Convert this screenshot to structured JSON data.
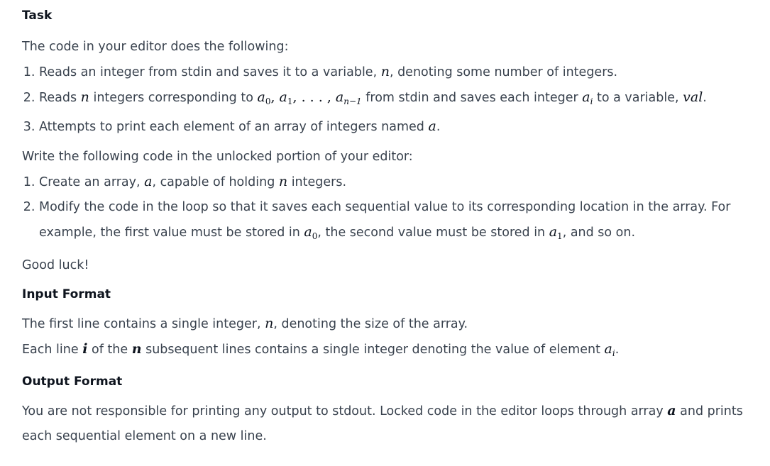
{
  "task": {
    "heading": "Task",
    "intro": "The code in your editor does the following:",
    "steps": {
      "s1_a": "Reads an integer from stdin and saves it to a variable, ",
      "s1_var": "n",
      "s1_b": ", denoting some number of integers.",
      "s2_a": "Reads ",
      "s2_var": "n",
      "s2_b": " integers corresponding to ",
      "s2_seq_a": "a",
      "s2_seq_0": "0",
      "s2_seq_sep1": ", ",
      "s2_seq_a1": "a",
      "s2_seq_1": "1",
      "s2_seq_dots": ", . . . , ",
      "s2_seq_an": "a",
      "s2_seq_n1": "n−1",
      "s2_c": " from stdin and saves each integer ",
      "s2_ai": "a",
      "s2_i": "i",
      "s2_d": " to a variable, ",
      "s2_val": "val",
      "s2_e": ".",
      "s3_a": "Attempts to print each element of an array of integers named ",
      "s3_var": "a",
      "s3_b": "."
    },
    "write_intro": "Write the following code in the unlocked portion of your editor:",
    "write_steps": {
      "w1_a": "Create an array, ",
      "w1_var": "a",
      "w1_b": ", capable of holding ",
      "w1_n": "n",
      "w1_c": " integers.",
      "w2_a": "Modify the code in the loop so that it saves each sequential value to its corresponding location in the array. For example, the first value must be stored in ",
      "w2_a0": "a",
      "w2_0": "0",
      "w2_b": ", the second value must be stored in ",
      "w2_a1": "a",
      "w2_1": "1",
      "w2_c": ", and so on."
    },
    "good_luck": "Good luck!"
  },
  "input_format": {
    "heading": "Input Format",
    "line1_a": "The first line contains a single integer, ",
    "line1_var": "n",
    "line1_b": ", denoting the size of the array.",
    "line2_a": "Each line ",
    "line2_i": "i",
    "line2_b": " of the ",
    "line2_n": "n",
    "line2_c": " subsequent lines contains a single integer denoting the value of element ",
    "line2_a_var": "a",
    "line2_sub": "i",
    "line2_d": "."
  },
  "output_format": {
    "heading": "Output Format",
    "text_a": "You are not responsible for printing any output to stdout. Locked code in the editor loops through array ",
    "text_var": "a",
    "text_b": " and prints each sequential element on a new line."
  }
}
